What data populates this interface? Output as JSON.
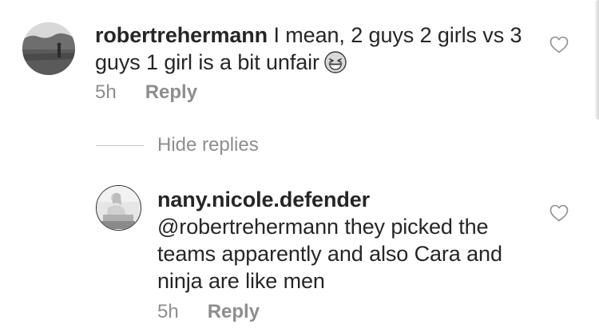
{
  "comment": {
    "username": "robertrehermann",
    "text": "I mean, 2 guys 2 girls vs 3 guys 1 girl is a bit unfair",
    "emoji": "grinning-squinting-face",
    "time": "5h",
    "reply_label": "Reply"
  },
  "replies_toggle": {
    "label": "Hide replies"
  },
  "reply": {
    "username": "nany.nicole.defender",
    "text": "@robertrehermann they picked the teams apparently and also Cara and ninja are like men",
    "time": "5h",
    "reply_label": "Reply"
  },
  "icons": {
    "like": "heart-outline-icon"
  },
  "colors": {
    "text": "#262626",
    "meta": "#8e8e8e",
    "divider": "#c7c7c7",
    "background": "#ffffff"
  }
}
